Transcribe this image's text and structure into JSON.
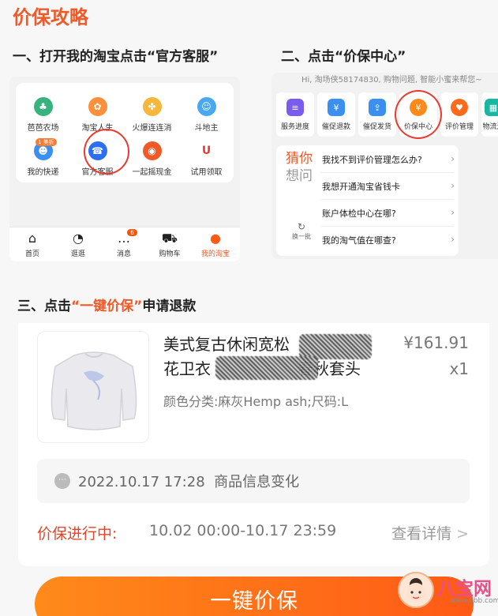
{
  "page_title": "价保攻略",
  "steps": {
    "step1": {
      "prefix": "一、打开我的淘宝点击",
      "highlight": "“官方客服”"
    },
    "step2": {
      "prefix": "二、点击",
      "highlight": "“价保中心”"
    },
    "step3": {
      "prefix": "三、点击",
      "highlight": "“一键价保”",
      "suffix": "申请退款"
    }
  },
  "panel1": {
    "grid": [
      {
        "label": "芭芭农场",
        "icon": "tree-icon",
        "color": "#36b37e"
      },
      {
        "label": "淘宝人生",
        "icon": "life-icon",
        "color": "#ff8f3a"
      },
      {
        "label": "火爆连连消",
        "icon": "match-icon",
        "color": "#f6b73c"
      },
      {
        "label": "斗地主",
        "icon": "cards-icon",
        "color": "#4aa8f0"
      },
      {
        "label": "我的快递",
        "icon": "delivery-icon",
        "color": "#3a8ff0",
        "badge": "1 美折"
      },
      {
        "label": "官方客服",
        "icon": "customer-service-icon",
        "color": "#2d6ff2"
      },
      {
        "label": "一起摇现金",
        "icon": "cash-icon",
        "color": "#f05a28"
      },
      {
        "label": "试用领取",
        "icon": "trial-icon",
        "color": "#e83a30"
      }
    ],
    "tabbar": [
      {
        "label": "首页",
        "icon": "home-icon",
        "glyph": "⌂"
      },
      {
        "label": "逛逛",
        "icon": "explore-icon",
        "glyph": "◔"
      },
      {
        "label": "消息",
        "icon": "message-icon",
        "glyph": "…",
        "badge": "6"
      },
      {
        "label": "购物车",
        "icon": "cart-icon",
        "glyph": "⛟"
      },
      {
        "label": "我的淘宝",
        "icon": "my-taobao-icon",
        "glyph": "●",
        "active": true
      }
    ]
  },
  "panel2": {
    "hint": "Hi, 淘场侠58174830, 购物问题, 智能小蜜来帮您~",
    "services": [
      {
        "label": "服务进度",
        "icon": "progress-icon",
        "color": "#7a5cf0",
        "glyph": "≡"
      },
      {
        "label": "催促退款",
        "icon": "refund-icon",
        "color": "#3a8ff0",
        "glyph": "¥"
      },
      {
        "label": "催促发货",
        "icon": "shipping-icon",
        "color": "#3a8ff0",
        "glyph": "⇪"
      },
      {
        "label": "价保中心",
        "icon": "price-protect-icon",
        "color": "#ff8a1a",
        "glyph": "¥"
      },
      {
        "label": "评价管理",
        "icon": "review-icon",
        "color": "#ff6a1a",
        "glyph": "♥"
      },
      {
        "label": "物流进",
        "icon": "logistics-icon",
        "color": "#19b6a0",
        "glyph": "▦"
      }
    ],
    "guess_line1": "猜你",
    "guess_line2": "想问",
    "refresh_label": "换一批",
    "faqs": [
      "我找不到评价管理怎么办?",
      "我想开通淘宝省钱卡",
      "账户体检中心在哪?",
      "我的淘气值在哪查?"
    ]
  },
  "order": {
    "product_title_line1": "美式复古休闲宽松",
    "product_title_line2a": "花卫衣",
    "product_title_line2b": "春秋套头",
    "price": "¥161.91",
    "quantity": "x1",
    "variant": "颜色分类:麻灰Hemp ash;尺码:L",
    "info_time": "2022.10.17 17:28",
    "info_text": "商品信息变化",
    "protect_label": "价保进行中:",
    "protect_time": "10.02 00:00-10.17 23:59",
    "details_label": "查看详情",
    "details_chevron": ">"
  },
  "button": {
    "label": "一键价保"
  },
  "watermark": {
    "text": "八宝网",
    "url": "www.8bb.com"
  }
}
